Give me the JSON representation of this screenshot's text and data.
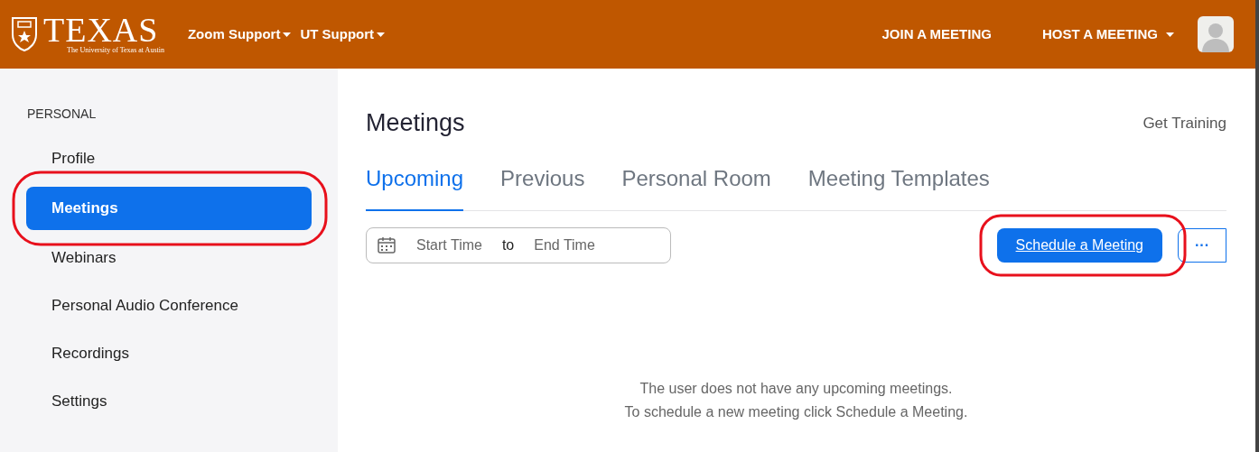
{
  "header": {
    "logo": {
      "wordmark": "TEXAS",
      "subtitle": "The University of Texas at Austin"
    },
    "nav": [
      {
        "label": "Zoom Support",
        "dropdown": true
      },
      {
        "label": "UT Support",
        "dropdown": true
      }
    ],
    "actions": [
      {
        "label": "JOIN A MEETING",
        "dropdown": false
      },
      {
        "label": "HOST A MEETING",
        "dropdown": true
      }
    ]
  },
  "sidebar": {
    "section": "PERSONAL",
    "items": [
      {
        "label": "Profile",
        "selected": false,
        "circled": false
      },
      {
        "label": "Meetings",
        "selected": true,
        "circled": true
      },
      {
        "label": "Webinars",
        "selected": false,
        "circled": false
      },
      {
        "label": "Personal Audio Conference",
        "selected": false,
        "circled": false
      },
      {
        "label": "Recordings",
        "selected": false,
        "circled": false
      },
      {
        "label": "Settings",
        "selected": false,
        "circled": false
      }
    ]
  },
  "main": {
    "title": "Meetings",
    "training_link": "Get Training",
    "tabs": [
      {
        "label": "Upcoming",
        "selected": true
      },
      {
        "label": "Previous",
        "selected": false
      },
      {
        "label": "Personal Room",
        "selected": false
      },
      {
        "label": "Meeting Templates",
        "selected": false
      }
    ],
    "date_range": {
      "start_placeholder": "Start Time",
      "separator": "to",
      "end_placeholder": "End Time"
    },
    "schedule_button": {
      "label": "Schedule a Meeting",
      "circled": true
    },
    "more_button": "···",
    "empty_message": [
      "The user does not have any upcoming meetings.",
      "To schedule a new meeting click Schedule a Meeting."
    ]
  }
}
